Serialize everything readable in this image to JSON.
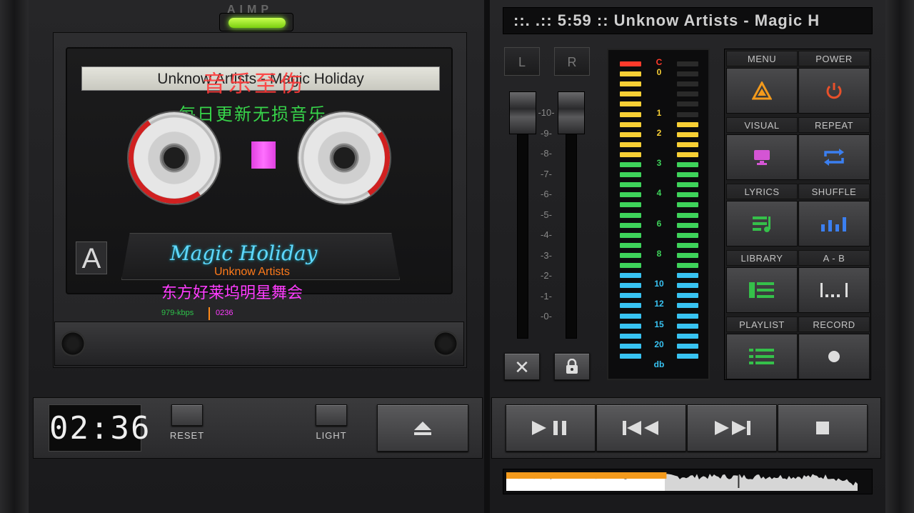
{
  "app": {
    "name": "AIMP"
  },
  "track_display": {
    "text": "::.   .:: 5:59 :: Unknow Artists - Magic H"
  },
  "cassette": {
    "label_text": "Unknow Artists - Magic Holiday",
    "overlay_title": "音乐至伤",
    "overlay_subtitle": "每日更新无损音乐",
    "side": "A",
    "script_title": "Magic Holiday",
    "artist": "Unknow Artists",
    "album_cn": "东方好莱坞明星舞会",
    "bitrate": "979-kbps",
    "time_small": "0236"
  },
  "channels": {
    "left": "L",
    "right": "R"
  },
  "fader_scale": [
    "10",
    "9",
    "8",
    "7",
    "6",
    "5",
    "4",
    "3",
    "2",
    "1",
    "0"
  ],
  "vu": {
    "labels": [
      "C",
      "0",
      "1",
      "2",
      "3",
      "4",
      "6",
      "8",
      "10",
      "12",
      "15",
      "20",
      "db"
    ],
    "left_level": 1.0,
    "right_level": 0.79
  },
  "controls": [
    {
      "label": "MENU",
      "icon": "aimp-logo-icon"
    },
    {
      "label": "POWER",
      "icon": "power-icon"
    },
    {
      "label": "VISUAL",
      "icon": "monitor-icon"
    },
    {
      "label": "REPEAT",
      "icon": "repeat-icon"
    },
    {
      "label": "LYRICS",
      "icon": "lyrics-icon"
    },
    {
      "label": "SHUFFLE",
      "icon": "shuffle-bars-icon"
    },
    {
      "label": "LIBRARY",
      "icon": "library-icon"
    },
    {
      "label": "A - B",
      "icon": "ab-repeat-icon"
    },
    {
      "label": "PLAYLIST",
      "icon": "playlist-icon"
    },
    {
      "label": "RECORD",
      "icon": "record-icon"
    }
  ],
  "bottom": {
    "clock": "02:36",
    "reset": "RESET",
    "light": "LIGHT"
  },
  "transport": [
    "play-pause-icon",
    "previous-icon",
    "next-icon",
    "stop-icon"
  ],
  "progress": {
    "fraction": 0.44
  },
  "colors": {
    "accent_orange": "#f39a1c",
    "led_green": "#9ae83a",
    "overlay_red": "#ff3b3b",
    "overlay_green": "#37d44a",
    "magenta": "#ff3cff",
    "cyan": "#5fd8ff"
  }
}
